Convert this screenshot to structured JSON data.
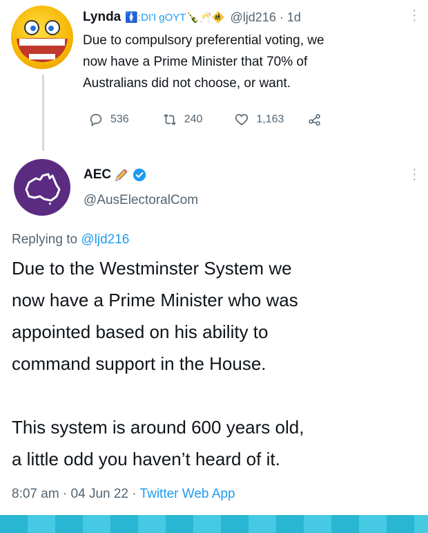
{
  "tweet1": {
    "author_name": "Lynda",
    "author_decor": "🚺:DI'I gOYT🍾🥂🚸",
    "handle_time": "@ljd216 · 1d",
    "text_lines": [
      "Due to compulsory preferential voting, we",
      "now have a Prime Minister that 70% of",
      "Australians did not choose, or want."
    ],
    "replies": "536",
    "retweets": "240",
    "likes": "1,163"
  },
  "tweet2": {
    "author_name": "AEC",
    "handle": "@AusElectoralCom",
    "replying_prefix": "Replying to",
    "replying_handle": "@ljd216",
    "text_lines": [
      "Due to the Westminster System we",
      "now have a Prime Minister who was",
      "appointed based on his ability to",
      "command support in the House.",
      "",
      "This system is around 600 years old,",
      "a little odd you haven’t heard of it."
    ],
    "time": "8:07 am · 04 Jun 22 ·",
    "source": "Twitter Web App"
  },
  "colors": {
    "accent": "#1d9bf0",
    "secondary_text": "#536471",
    "aec_purple": "#5b2b82",
    "bottom_strip": "#28b6d3"
  },
  "icons": [
    "reply-icon",
    "retweet-icon",
    "like-icon",
    "share-icon",
    "more-icon",
    "verified-badge-icon",
    "pencil-icon",
    "australia-map-icon"
  ]
}
